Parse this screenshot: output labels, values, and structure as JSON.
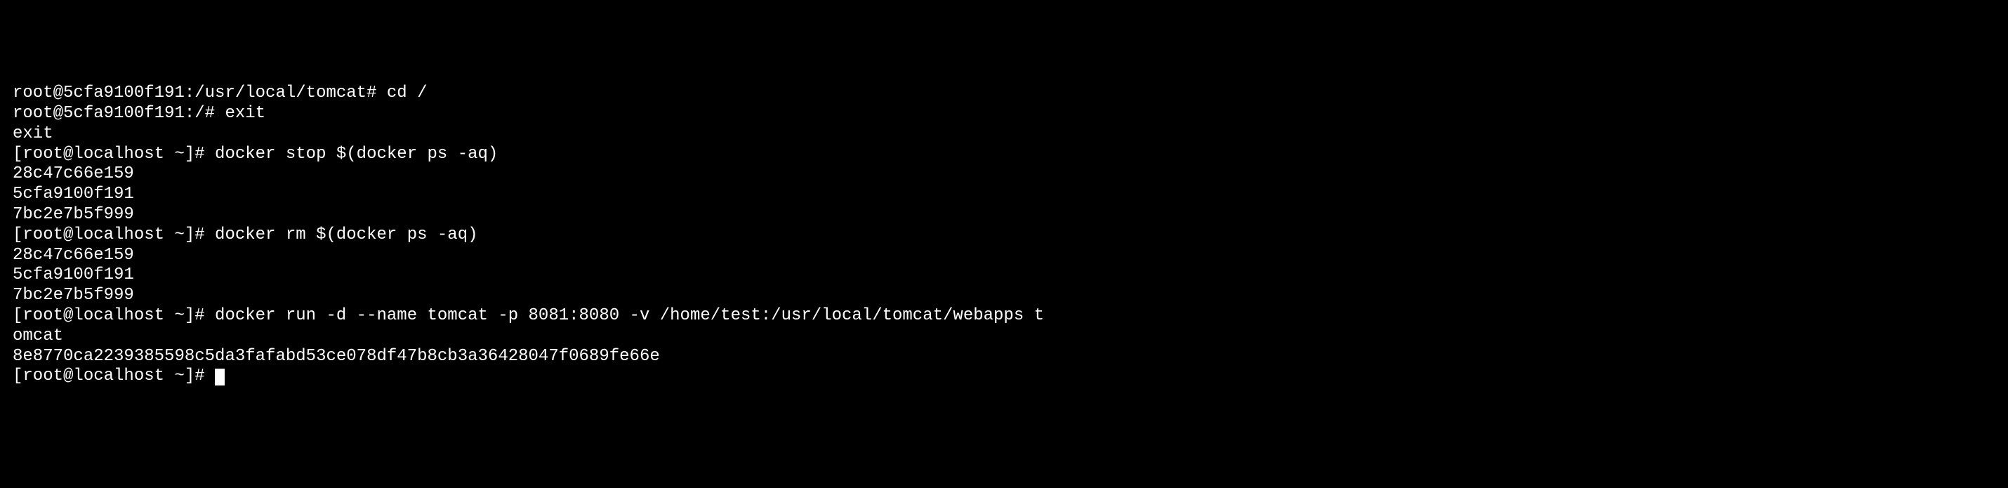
{
  "lines": [
    {
      "prompt": "root@5cfa9100f191:/usr/local/tomcat# ",
      "command": "cd /"
    },
    {
      "prompt": "root@5cfa9100f191:/# ",
      "command": "exit"
    },
    {
      "output": "exit"
    },
    {
      "prompt": "[root@localhost ~]# ",
      "command": "docker stop $(docker ps -aq)"
    },
    {
      "output": "28c47c66e159"
    },
    {
      "output": "5cfa9100f191"
    },
    {
      "output": "7bc2e7b5f999"
    },
    {
      "prompt": "[root@localhost ~]# ",
      "command": "docker rm $(docker ps -aq)"
    },
    {
      "output": "28c47c66e159"
    },
    {
      "output": "5cfa9100f191"
    },
    {
      "output": "7bc2e7b5f999"
    },
    {
      "prompt": "[root@localhost ~]# ",
      "command": "docker run -d --name tomcat -p 8081:8080 -v /home/test:/usr/local/tomcat/webapps t"
    },
    {
      "output": "omcat"
    },
    {
      "output": "8e8770ca2239385598c5da3fafabd53ce078df47b8cb3a36428047f0689fe66e"
    },
    {
      "prompt": "[root@localhost ~]# ",
      "command": "",
      "cursor": true
    }
  ]
}
